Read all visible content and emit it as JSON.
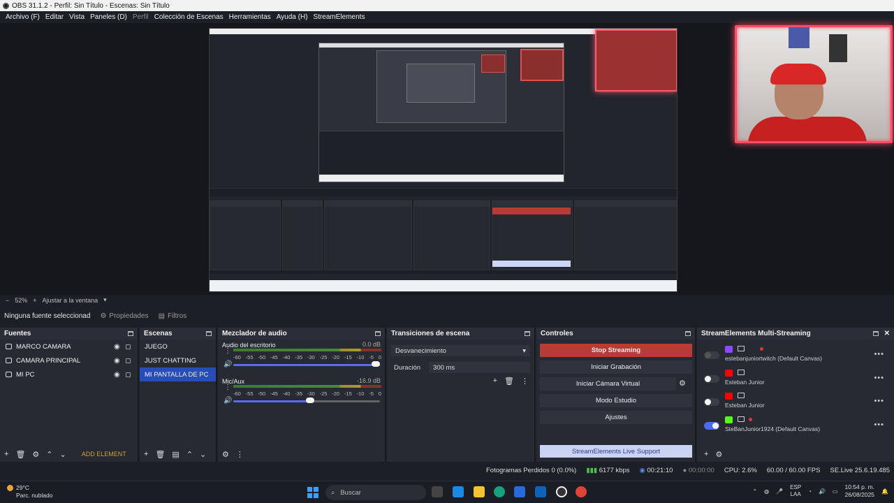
{
  "window": {
    "title": "OBS 31.1.2 - Perfil: Sin Título - Escenas: Sin Título"
  },
  "menu": [
    {
      "label": "Archivo (F)",
      "dim": false
    },
    {
      "label": "Editar",
      "dim": false
    },
    {
      "label": "Vista",
      "dim": false
    },
    {
      "label": "Paneles (D)",
      "dim": false
    },
    {
      "label": "Perfil",
      "dim": true
    },
    {
      "label": "Colección de Escenas",
      "dim": false
    },
    {
      "label": "Herramientas",
      "dim": false
    },
    {
      "label": "Ayuda (H)",
      "dim": false
    },
    {
      "label": "StreamElements",
      "dim": false
    }
  ],
  "zoom": {
    "value": "52%",
    "fit_label": "Ajustar a la ventana"
  },
  "source_toolbar": {
    "no_source": "Ninguna fuente seleccionad",
    "properties": "Propiedades",
    "filters": "Filtros"
  },
  "sources": {
    "title": "Fuentes",
    "items": [
      {
        "label": "MARCO CAMARA"
      },
      {
        "label": "CAMARA PRINCIPAL"
      },
      {
        "label": "MI PC"
      }
    ],
    "add_element": "ADD ELEMENT"
  },
  "scenes": {
    "title": "Escenas",
    "items": [
      {
        "label": "JUEGO",
        "selected": false
      },
      {
        "label": "JUST CHATTING",
        "selected": false
      },
      {
        "label": "MI PANTALLA DE PC",
        "selected": true
      }
    ]
  },
  "mixer": {
    "title": "Mezclador de audio",
    "channels": [
      {
        "name": "Audio del escritorio",
        "db": "0.0 dB",
        "volume_fraction": 1.0
      },
      {
        "name": "Mic/Aux",
        "db": "-16.9 dB",
        "volume_fraction": 0.55
      }
    ],
    "ticks": [
      "-60",
      "-55",
      "-50",
      "-45",
      "-40",
      "-35",
      "-30",
      "-25",
      "-20",
      "-15",
      "-10",
      "-5",
      "0"
    ]
  },
  "transitions": {
    "title": "Transiciones de escena",
    "selected": "Desvanecimiento",
    "duration_label": "Duración",
    "duration_value": "300 ms"
  },
  "controls": {
    "title": "Controles",
    "stop_streaming": "Stop Streaming",
    "start_recording": "Iniciar Grabación",
    "start_virtual_cam": "Iniciar Cámara Virtual",
    "studio_mode": "Modo Estudio",
    "settings": "Ajustes",
    "se_support": "StreamElements Live Support"
  },
  "se_multistreaming": {
    "title": "StreamElements Multi-Streaming",
    "targets": [
      {
        "name": "estebanjuniortwitch (Default Canvas)",
        "platform": "twitch",
        "platform_color": "#9146ff",
        "enabled": false,
        "disabled_toggle": true,
        "live": true
      },
      {
        "name": "Esteban Junior",
        "platform": "youtube",
        "platform_color": "#ff0000",
        "enabled": false,
        "disabled_toggle": false,
        "live": false
      },
      {
        "name": "Esteban Junior",
        "platform": "youtube",
        "platform_color": "#ff0000",
        "enabled": false,
        "disabled_toggle": false,
        "live": false
      },
      {
        "name": "SteBanJunior1924 (Default Canvas)",
        "platform": "kick",
        "platform_color": "#53fc18",
        "enabled": true,
        "disabled_toggle": false,
        "live": true
      }
    ]
  },
  "status": {
    "dropped_frames": "Fotogramas Perdidos 0 (0.0%)",
    "bitrate": "6177 kbps",
    "stream_time": "00:21:10",
    "rec_time": "00:00:00",
    "cpu": "CPU: 2.6%",
    "fps": "60.00 / 60.00 FPS",
    "se_version": "SE.Live 25.6.19.485"
  },
  "taskbar": {
    "temperature": "29°C",
    "weather": "Parc. nublado",
    "search_placeholder": "Buscar",
    "lang_top": "ESP",
    "lang_bottom": "LAA",
    "time": "10:54 p. m.",
    "date": "26/08/2025"
  },
  "colors": {
    "accent": "#284cb8",
    "stop": "#b93b35",
    "toggle_on": "#4c6cf0",
    "webcam_border": "#ff4c63"
  }
}
